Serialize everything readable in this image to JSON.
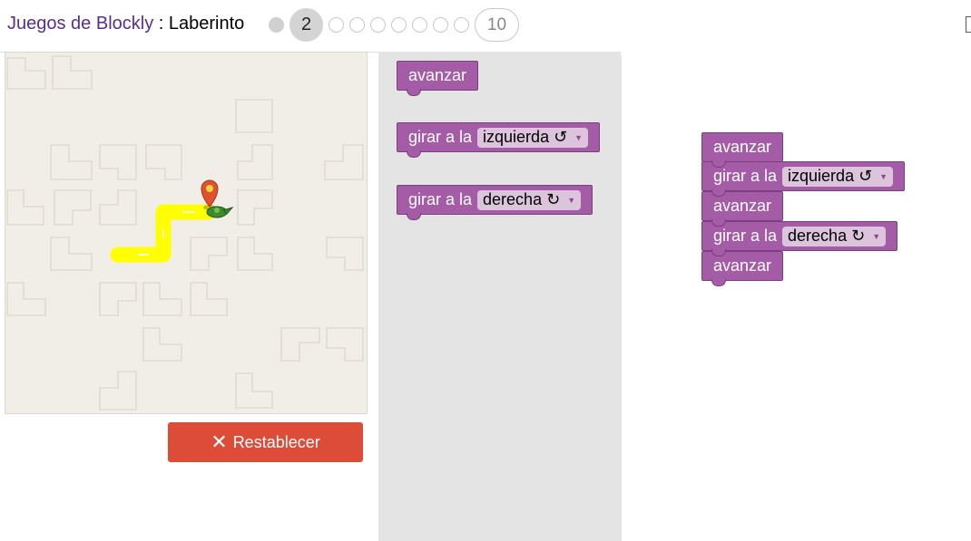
{
  "header": {
    "game_label": "Juegos de Blockly",
    "separator": " : ",
    "puzzle_label": "Laberinto",
    "current_level": "2",
    "last_level": "10"
  },
  "maze": {
    "reset_label": "Restablecer"
  },
  "toolbox": {
    "move_label": "avanzar",
    "turn_prefix": "girar a la",
    "left_option": "izquierda",
    "right_option": "derecha",
    "left_glyph": "↺",
    "right_glyph": "↻"
  },
  "workspace": {
    "blocks": [
      {
        "label": "avanzar"
      },
      {
        "label": "girar a la",
        "option": "izquierda",
        "glyph": "↺"
      },
      {
        "label": "avanzar"
      },
      {
        "label": "girar a la",
        "option": "derecha",
        "glyph": "↻"
      },
      {
        "label": "avanzar"
      }
    ]
  },
  "colors": {
    "block": "#a55ca6",
    "reset": "#dd4b39",
    "path": "#ffff00",
    "game_title": "#5b2d8c"
  }
}
